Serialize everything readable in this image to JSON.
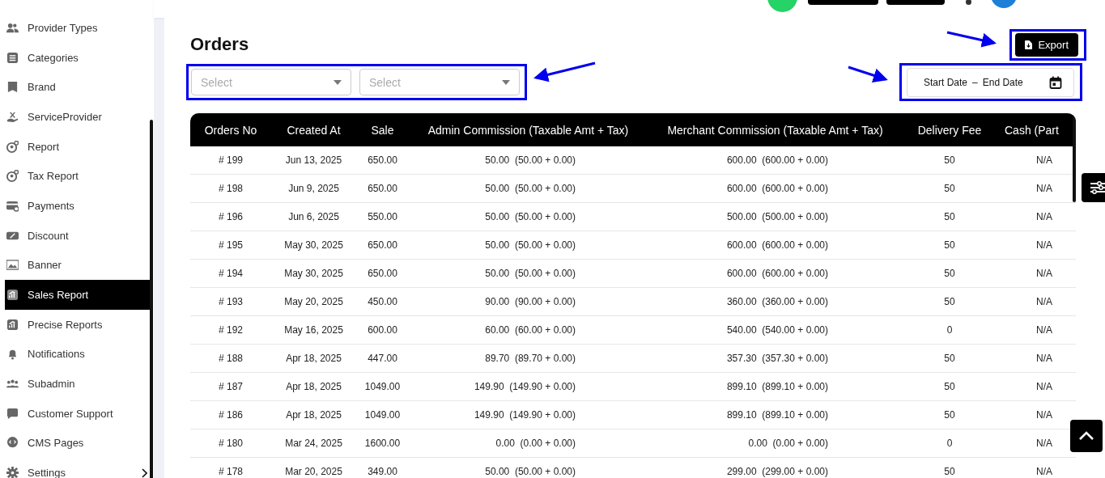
{
  "sidebar": {
    "items": [
      {
        "label": "Provider Types",
        "selected": false,
        "expandable": false
      },
      {
        "label": "Categories",
        "selected": false,
        "expandable": false
      },
      {
        "label": "Brand",
        "selected": false,
        "expandable": false
      },
      {
        "label": "ServiceProvider",
        "selected": false,
        "expandable": false
      },
      {
        "label": "Report",
        "selected": false,
        "expandable": false
      },
      {
        "label": "Tax Report",
        "selected": false,
        "expandable": false
      },
      {
        "label": "Payments",
        "selected": false,
        "expandable": false
      },
      {
        "label": "Discount",
        "selected": false,
        "expandable": false
      },
      {
        "label": "Banner",
        "selected": false,
        "expandable": false
      },
      {
        "label": "Sales Report",
        "selected": true,
        "expandable": false
      },
      {
        "label": "Precise Reports",
        "selected": false,
        "expandable": false
      },
      {
        "label": "Notifications",
        "selected": false,
        "expandable": false
      },
      {
        "label": "Subadmin",
        "selected": false,
        "expandable": false
      },
      {
        "label": "Customer Support",
        "selected": false,
        "expandable": false
      },
      {
        "label": "CMS Pages",
        "selected": false,
        "expandable": false
      },
      {
        "label": "Settings",
        "selected": false,
        "expandable": true
      }
    ]
  },
  "page": {
    "title": "Orders",
    "export_button": "Export",
    "filters": [
      {
        "placeholder": "Select"
      },
      {
        "placeholder": "Select"
      }
    ],
    "date_range": {
      "start": "Start Date",
      "separator": "–",
      "end": "End Date"
    }
  },
  "table": {
    "columns": [
      "Orders No",
      "Created At",
      "Sale",
      "Admin Commission (Taxable Amt + Tax)",
      "Merchant Commission (Taxable Amt + Tax)",
      "Delivery Fee",
      "Cash (Part"
    ],
    "rows": [
      [
        "# 199",
        "Jun 13, 2025",
        "650.00",
        "50.00  (50.00 + 0.00)",
        "600.00  (600.00 + 0.00)",
        "50",
        "N/A"
      ],
      [
        "# 198",
        "Jun 9, 2025",
        "650.00",
        "50.00  (50.00 + 0.00)",
        "600.00  (600.00 + 0.00)",
        "50",
        "N/A"
      ],
      [
        "# 196",
        "Jun 6, 2025",
        "550.00",
        "50.00  (50.00 + 0.00)",
        "500.00  (500.00 + 0.00)",
        "50",
        "N/A"
      ],
      [
        "# 195",
        "May 30, 2025",
        "650.00",
        "50.00  (50.00 + 0.00)",
        "600.00  (600.00 + 0.00)",
        "50",
        "N/A"
      ],
      [
        "# 194",
        "May 30, 2025",
        "650.00",
        "50.00  (50.00 + 0.00)",
        "600.00  (600.00 + 0.00)",
        "50",
        "N/A"
      ],
      [
        "# 193",
        "May 20, 2025",
        "450.00",
        "90.00  (90.00 + 0.00)",
        "360.00  (360.00 + 0.00)",
        "50",
        "N/A"
      ],
      [
        "# 192",
        "May 16, 2025",
        "600.00",
        "60.00  (60.00 + 0.00)",
        "540.00  (540.00 + 0.00)",
        "0",
        "N/A"
      ],
      [
        "# 188",
        "Apr 18, 2025",
        "447.00",
        "89.70  (89.70 + 0.00)",
        "357.30  (357.30 + 0.00)",
        "50",
        "N/A"
      ],
      [
        "# 187",
        "Apr 18, 2025",
        "1049.00",
        "149.90  (149.90 + 0.00)",
        "899.10  (899.10 + 0.00)",
        "50",
        "N/A"
      ],
      [
        "# 186",
        "Apr 18, 2025",
        "1049.00",
        "149.90  (149.90 + 0.00)",
        "899.10  (899.10 + 0.00)",
        "50",
        "N/A"
      ],
      [
        "# 180",
        "Mar 24, 2025",
        "1600.00",
        "0.00  (0.00 + 0.00)",
        "0.00  (0.00 + 0.00)",
        "0",
        "N/A"
      ],
      [
        "# 178",
        "Mar 20, 2025",
        "349.00",
        "50.00  (50.00 + 0.00)",
        "299.00  (299.00 + 0.00)",
        "50",
        "N/A"
      ]
    ]
  }
}
